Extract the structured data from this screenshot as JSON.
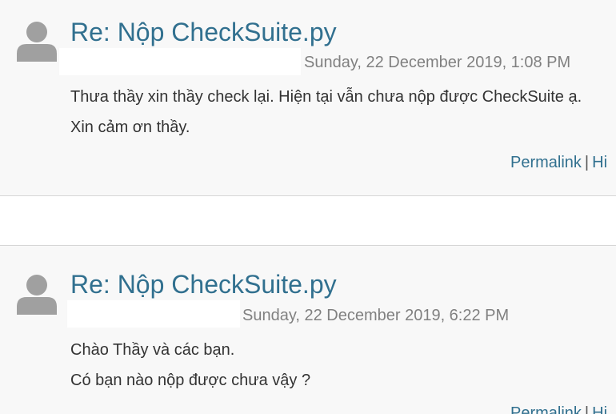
{
  "posts": [
    {
      "subject": "Re: Nộp CheckSuite.py",
      "author": "",
      "date": "Sunday, 22 December 2019, 1:08 PM",
      "message": [
        "Thưa thầy xin thầy check lại. Hiện tại vẫn chưa nộp được CheckSuite ạ.",
        "Xin cảm ơn thầy."
      ],
      "commands": {
        "permalink": "Permalink",
        "separator": "|",
        "next": "Hi"
      }
    },
    {
      "subject": "Re: Nộp CheckSuite.py",
      "author": "",
      "date": "Sunday, 22 December 2019, 6:22 PM",
      "message": [
        "Chào Thầy và các bạn.",
        "Có bạn nào nộp được chưa vậy ?"
      ],
      "commands": {
        "permalink": "Permalink",
        "separator": "|",
        "next": "Hi"
      }
    }
  ],
  "colors": {
    "link": "#31708f",
    "date": "#808080",
    "text": "#333333",
    "post_background": "#f8f8f8",
    "avatar": "#a0a0a0"
  },
  "icons": {
    "avatar": "user-silhouette-icon"
  }
}
